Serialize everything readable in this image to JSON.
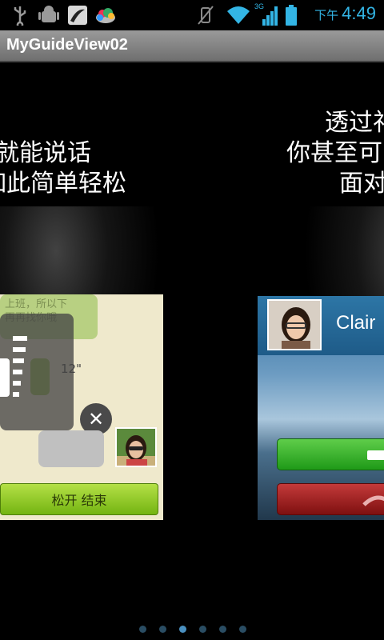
{
  "status_bar": {
    "icons": [
      "usb-icon",
      "android-debug-icon",
      "notification-app-icon",
      "cloud-icon",
      "vibrate-icon",
      "wifi-icon",
      "signal-3g-icon",
      "battery-icon"
    ],
    "signal_label": "3G",
    "time_prefix": "下午",
    "time": "4:49",
    "time_color": "#33b5e5"
  },
  "title_bar": {
    "title": "MyGuideView02"
  },
  "pages": {
    "left": {
      "caption_line1": "就能说话",
      "caption_line2": "如此简单轻松",
      "chat_faded_text": "上班，所以下\n再再找你哦",
      "record_seconds": "12\"",
      "release_button": "松开  结束"
    },
    "right": {
      "caption_line1": "透过礼",
      "caption_line2": "你甚至可",
      "caption_line3": "面对",
      "caller_name": "Clair"
    }
  },
  "page_indicator": {
    "count": 6,
    "active_index": 2
  }
}
